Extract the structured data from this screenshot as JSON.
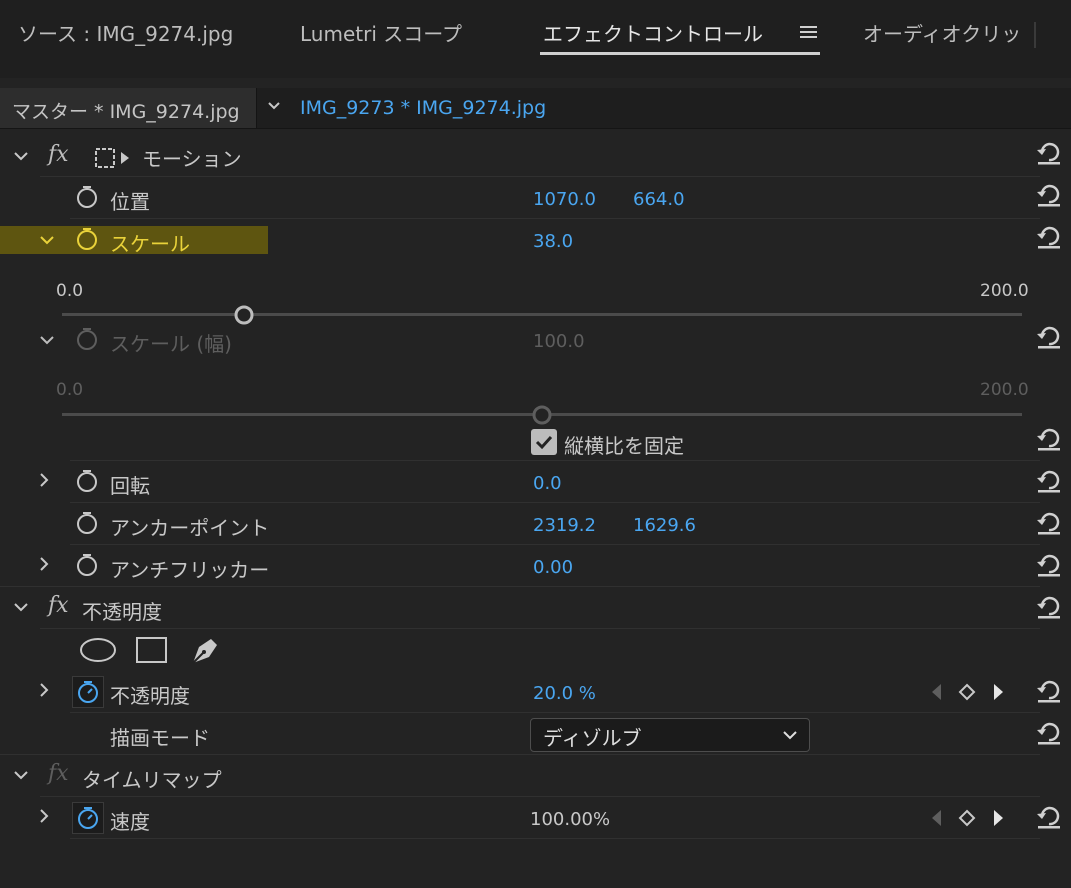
{
  "tabs": [
    {
      "label": "ソース : IMG_9274.jpg"
    },
    {
      "label": "Lumetri スコープ"
    },
    {
      "label": "エフェクトコントロール"
    },
    {
      "label": "オーディオクリッ"
    }
  ],
  "clip": {
    "master": "マスター * IMG_9274.jpg",
    "current": "IMG_9273 * IMG_9274.jpg"
  },
  "motion": {
    "title": "モーション",
    "position": {
      "label": "位置",
      "x": "1070.0",
      "y": "664.0"
    },
    "scale": {
      "label": "スケール",
      "value": "38.0",
      "min": "0.0",
      "max": "200.0",
      "fraction": 0.19
    },
    "scale_width": {
      "label": "スケール (幅)",
      "value": "100.0",
      "min": "0.0",
      "max": "200.0",
      "fraction": 0.5
    },
    "uniform_scale": {
      "label": "縦横比を固定",
      "checked": true
    },
    "rotation": {
      "label": "回転",
      "value": "0.0"
    },
    "anchor": {
      "label": "アンカーポイント",
      "x": "2319.2",
      "y": "1629.6"
    },
    "anti_flicker": {
      "label": "アンチフリッカー",
      "value": "0.00"
    }
  },
  "opacity": {
    "title": "不透明度",
    "opacity": {
      "label": "不透明度",
      "value": "20.0 %"
    },
    "blend_mode": {
      "label": "描画モード",
      "value": "ディゾルブ"
    }
  },
  "time_remap": {
    "title": "タイムリマップ",
    "speed": {
      "label": "速度",
      "value": "100.00%"
    }
  },
  "colors": {
    "accent": "#4aa6f0",
    "highlight_text": "#e9d23a",
    "highlight_bg": "#5e5510",
    "bg": "#232323"
  }
}
